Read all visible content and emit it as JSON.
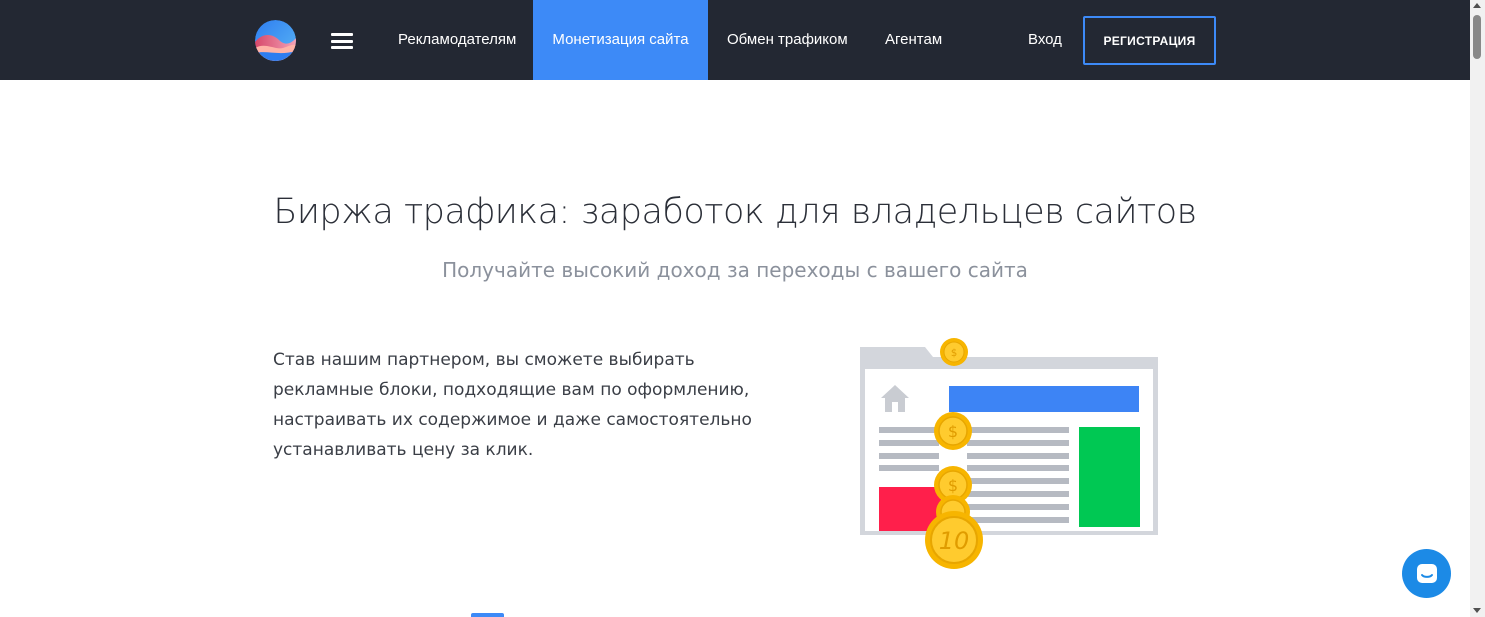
{
  "header": {
    "nav": [
      {
        "label": "Рекламодателям"
      },
      {
        "label": "Монетизация сайта",
        "active": true
      },
      {
        "label": "Обмен трафиком"
      },
      {
        "label": "Агентам"
      }
    ],
    "login_label": "Вход",
    "register_label": "РЕГИСТРАЦИЯ"
  },
  "hero": {
    "title": "Биржа трафика: заработок для владельцев сайтов",
    "subtitle": "Получайте высокий доход за переходы с вашего сайта",
    "body": "Став нашим партнером, вы сможете выбирать рекламные блоки, подходящие вам по оформлению, настраивать их содержимое и даже самостоятельно устанавливать цену за клик."
  },
  "illustration": {
    "coin_labels": [
      "$",
      "$",
      "10"
    ]
  },
  "colors": {
    "header_bg": "#232833",
    "accent": "#3d8af7",
    "coin": "#f7b500",
    "ad_green": "#00c853",
    "ad_red": "#ff1f4b",
    "chat": "#1c8ae6"
  },
  "icons": {
    "logo": "logo-icon",
    "menu": "hamburger-icon",
    "home": "home-icon",
    "chat": "chat-icon"
  }
}
